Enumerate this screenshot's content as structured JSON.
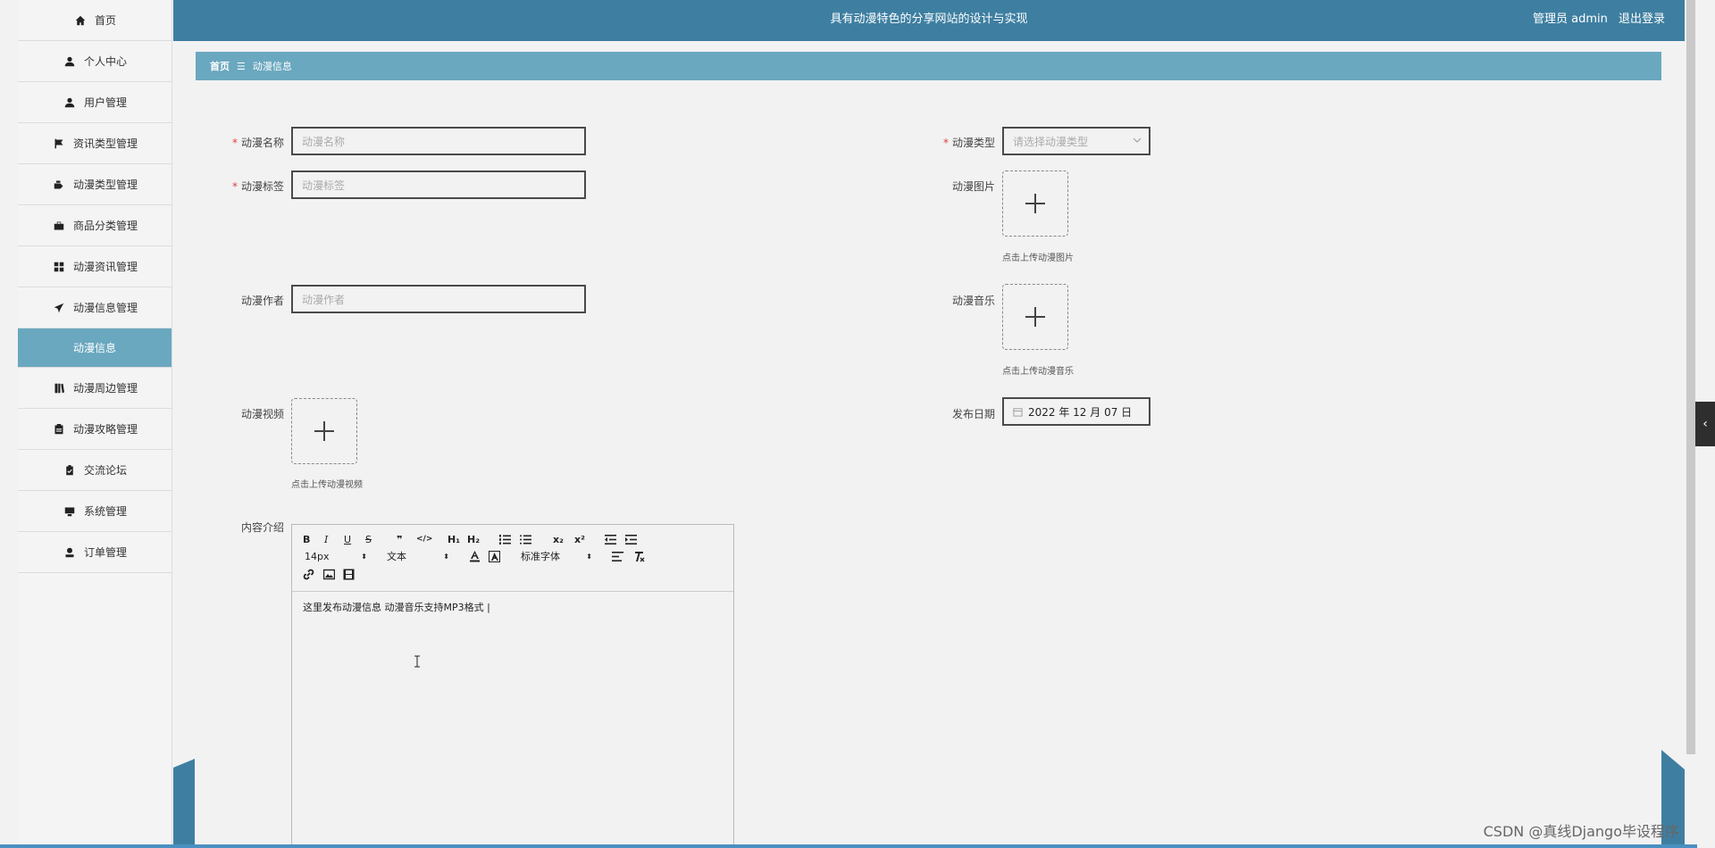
{
  "header": {
    "title": "具有动漫特色的分享网站的设计与实现",
    "user_role": "管理员 admin",
    "logout": "退出登录"
  },
  "sidebar": {
    "items": [
      {
        "label": "首页",
        "icon": "home-icon"
      },
      {
        "label": "个人中心",
        "icon": "person-icon"
      },
      {
        "label": "用户管理",
        "icon": "person-icon"
      },
      {
        "label": "资讯类型管理",
        "icon": "flag-icon"
      },
      {
        "label": "动漫类型管理",
        "icon": "tag-icon"
      },
      {
        "label": "商品分类管理",
        "icon": "briefcase-icon"
      },
      {
        "label": "动漫资讯管理",
        "icon": "grid-icon"
      },
      {
        "label": "动漫信息管理",
        "icon": "paper-plane-icon"
      }
    ],
    "active_sub": "动漫信息",
    "items_after": [
      {
        "label": "动漫周边管理",
        "icon": "book-icon"
      },
      {
        "label": "动漫攻略管理",
        "icon": "document-icon"
      },
      {
        "label": "交流论坛",
        "icon": "clipboard-icon"
      },
      {
        "label": "系统管理",
        "icon": "monitor-icon"
      },
      {
        "label": "订单管理",
        "icon": "user-icon"
      }
    ]
  },
  "breadcrumb": {
    "home": "首页",
    "sep": "☰",
    "current": "动漫信息"
  },
  "form": {
    "name_label": "动漫名称",
    "name_placeholder": "动漫名称",
    "tag_label": "动漫标签",
    "tag_placeholder": "动漫标签",
    "author_label": "动漫作者",
    "author_placeholder": "动漫作者",
    "video_label": "动漫视频",
    "video_tip": "点击上传动漫视频",
    "type_label": "动漫类型",
    "type_placeholder": "请选择动漫类型",
    "image_label": "动漫图片",
    "image_tip": "点击上传动漫图片",
    "music_label": "动漫音乐",
    "music_tip": "点击上传动漫音乐",
    "date_label": "发布日期",
    "date_value": "2022 年 12 月 07 日",
    "content_label": "内容介绍",
    "required_mark": "*"
  },
  "editor": {
    "font_size": "14px",
    "block_type": "文本",
    "font_family": "标准字体",
    "buttons": {
      "bold": "B",
      "italic": "I",
      "underline": "U",
      "strike": "S",
      "quote": "❞",
      "code": "</>",
      "h1": "H₁",
      "h2": "H₂",
      "sub": "x₂",
      "sup": "x²"
    },
    "content": "这里发布动漫信息  动漫音乐支持MP3格式 |"
  },
  "watermark": "CSDN @真线Django毕设程序"
}
